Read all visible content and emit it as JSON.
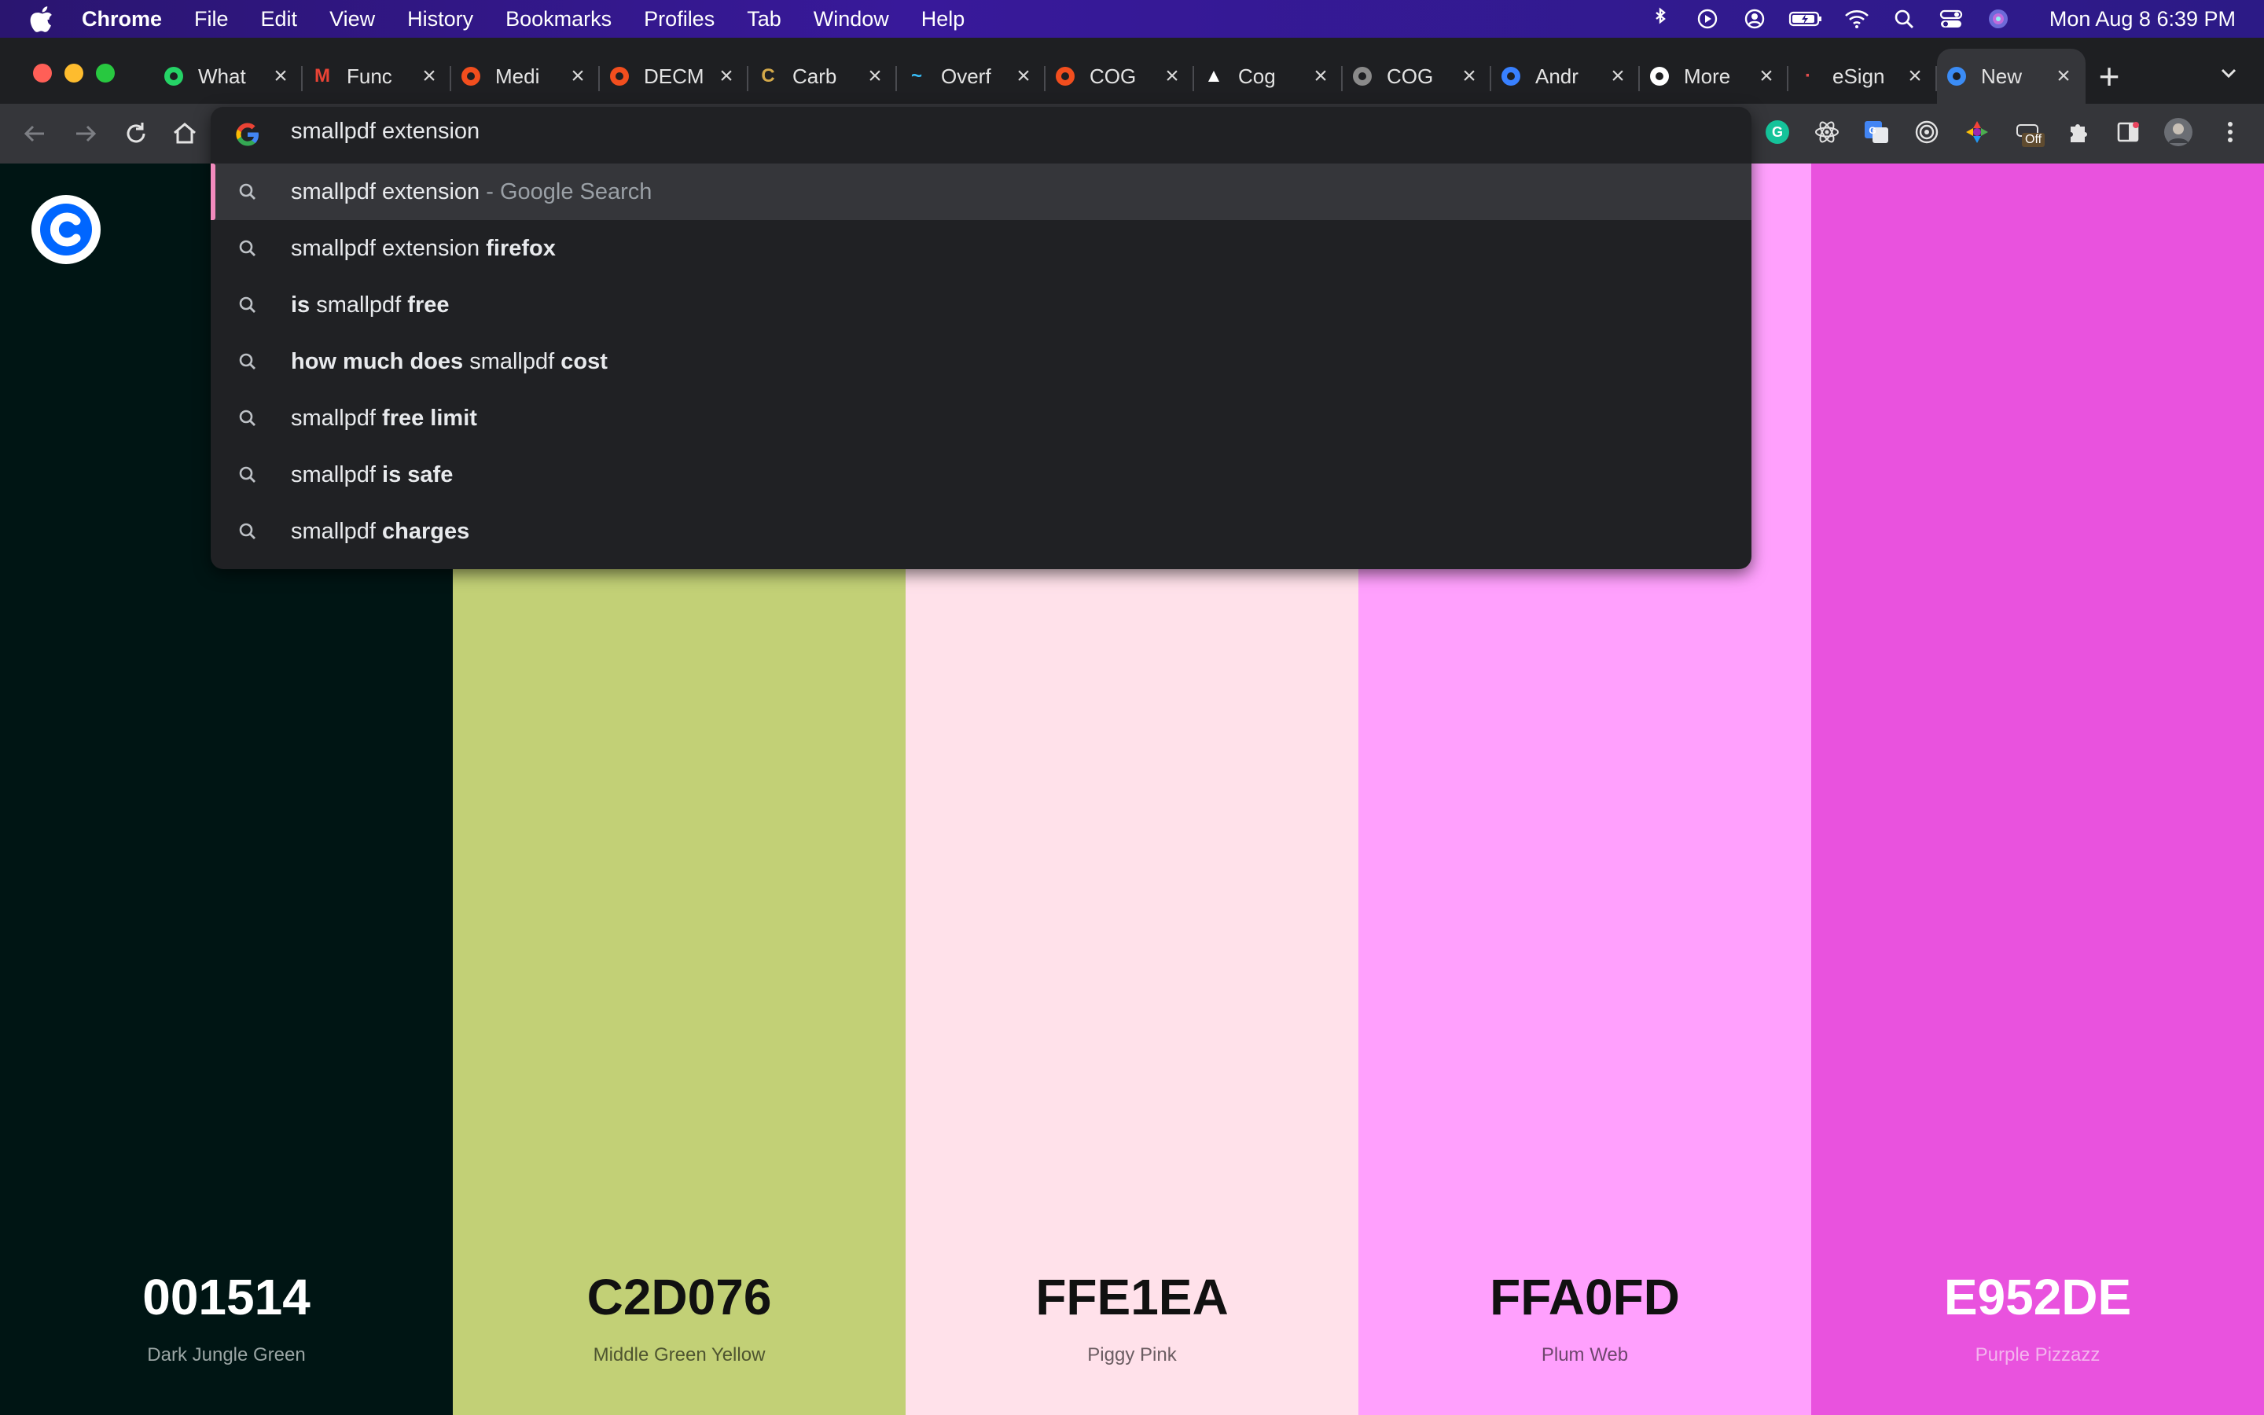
{
  "menubar": {
    "app": "Chrome",
    "items": [
      "File",
      "Edit",
      "View",
      "History",
      "Bookmarks",
      "Profiles",
      "Tab",
      "Window",
      "Help"
    ],
    "clock": "Mon Aug 8  6:39 PM"
  },
  "tabs": [
    {
      "title": "What",
      "icon": "whatsapp-icon",
      "fav": "",
      "color": "#25d366"
    },
    {
      "title": "Func",
      "icon": "gmail-icon",
      "fav": "M",
      "color": "#ea4335"
    },
    {
      "title": "Medi",
      "icon": "figma-icon",
      "fav": "",
      "color": "#f24e1e"
    },
    {
      "title": "DECM",
      "icon": "figma-icon",
      "fav": "",
      "color": "#f24e1e"
    },
    {
      "title": "Carb",
      "icon": "carbon-icon",
      "fav": "C",
      "color": "#d4a94a"
    },
    {
      "title": "Overf",
      "icon": "tailwind-icon",
      "fav": "~",
      "color": "#38bdf8"
    },
    {
      "title": "COG",
      "icon": "figma-icon",
      "fav": "",
      "color": "#f24e1e"
    },
    {
      "title": "Cog",
      "icon": "vercel-icon",
      "fav": "▲",
      "color": "#ffffff"
    },
    {
      "title": "COG",
      "icon": "globe-icon",
      "fav": "",
      "color": "#8a8a8a"
    },
    {
      "title": "Andr",
      "icon": "ionic-icon",
      "fav": "",
      "color": "#3880ff"
    },
    {
      "title": "More",
      "icon": "github-icon",
      "fav": "",
      "color": "#ffffff"
    },
    {
      "title": "eSign",
      "icon": "esign-icon",
      "fav": "·",
      "color": "#e34d4d"
    },
    {
      "title": "New",
      "icon": "coolors-icon",
      "fav": "",
      "color": "#3b8cf5"
    }
  ],
  "omnibox": {
    "input": "smallpdf extension",
    "suggestions": [
      {
        "parts": [
          {
            "t": "smallpdf extension",
            "b": false
          },
          {
            "t": " - Google Search",
            "b": false,
            "hint": true
          }
        ]
      },
      {
        "parts": [
          {
            "t": "smallpdf extension ",
            "b": false
          },
          {
            "t": "firefox",
            "b": true
          }
        ]
      },
      {
        "parts": [
          {
            "t": "is",
            "b": true
          },
          {
            "t": " smallpdf ",
            "b": false
          },
          {
            "t": "free",
            "b": true
          }
        ]
      },
      {
        "parts": [
          {
            "t": "how much does",
            "b": true
          },
          {
            "t": " smallpdf ",
            "b": false
          },
          {
            "t": "cost",
            "b": true
          }
        ]
      },
      {
        "parts": [
          {
            "t": "smallpdf ",
            "b": false
          },
          {
            "t": "free limit",
            "b": true
          }
        ]
      },
      {
        "parts": [
          {
            "t": "smallpdf ",
            "b": false
          },
          {
            "t": "is safe",
            "b": true
          }
        ]
      },
      {
        "parts": [
          {
            "t": "smallpdf ",
            "b": false
          },
          {
            "t": "charges",
            "b": true
          }
        ]
      }
    ]
  },
  "toolbar": {
    "extension_badge": "Off"
  },
  "palette": [
    {
      "hex": "001514",
      "name": "Dark Jungle Green",
      "color": "#001514",
      "text": "#ffffff",
      "sub": "#9aa5a4"
    },
    {
      "hex": "C2D076",
      "name": "Middle Green Yellow",
      "color": "#c2d076",
      "text": "#111111",
      "sub": "#4f5530"
    },
    {
      "hex": "FFE1EA",
      "name": "Piggy Pink",
      "color": "#ffe1ea",
      "text": "#111111",
      "sub": "#6b5d62"
    },
    {
      "hex": "FFA0FD",
      "name": "Plum Web",
      "color": "#ffa0fd",
      "text": "#111111",
      "sub": "#6e466d"
    },
    {
      "hex": "E952DE",
      "name": "Purple Pizzazz",
      "color": "#e952de",
      "text": "#ffffff",
      "sub": "#f4b4ee"
    }
  ]
}
